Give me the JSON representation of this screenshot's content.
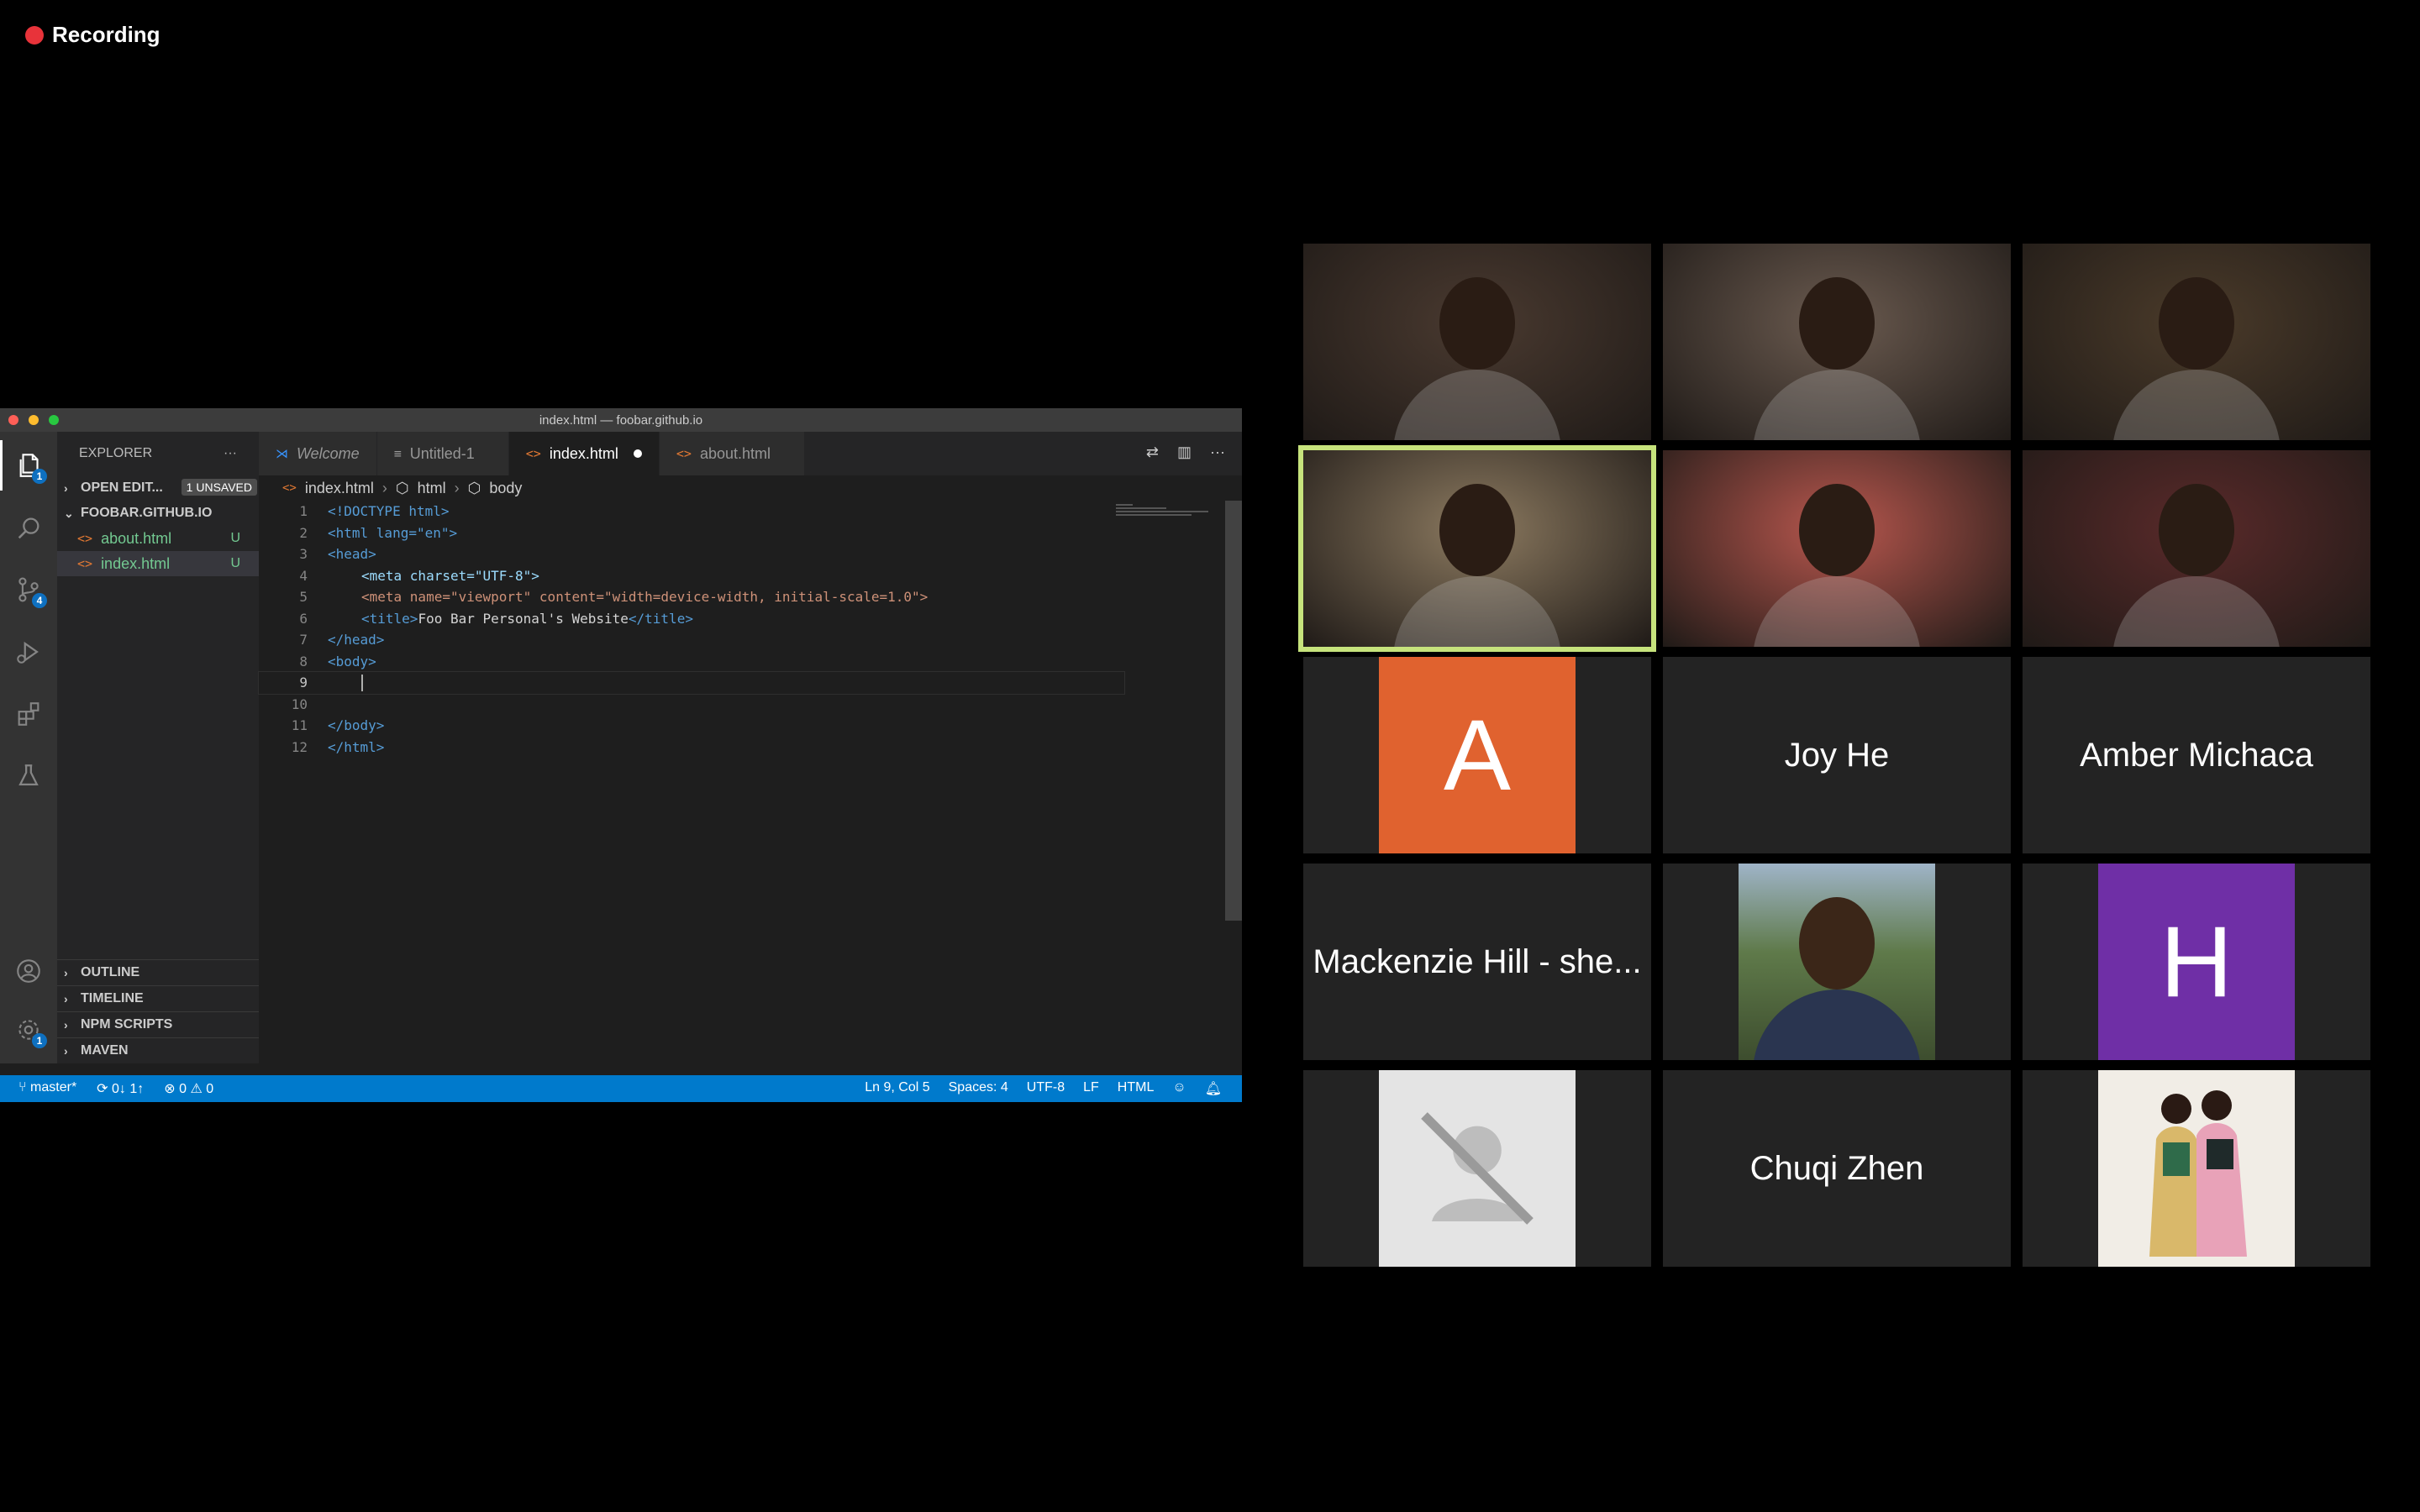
{
  "recording": {
    "label": "Recording"
  },
  "vscode": {
    "window_title": "index.html — foobar.github.io",
    "activity_badges": {
      "explorer": "1",
      "scm": "4",
      "settings": "1"
    },
    "sidebar": {
      "title": "EXPLORER",
      "more": "···",
      "open_editors": "OPEN EDIT...",
      "unsaved": "1 UNSAVED",
      "folder": "FOOBAR.GITHUB.IO",
      "files": [
        {
          "name": "about.html",
          "status": "U"
        },
        {
          "name": "index.html",
          "status": "U"
        }
      ],
      "bottom_sections": [
        "OUTLINE",
        "TIMELINE",
        "NPM SCRIPTS",
        "MAVEN"
      ]
    },
    "tabs": [
      {
        "label": "Welcome"
      },
      {
        "label": "Untitled-1"
      },
      {
        "label": "index.html"
      },
      {
        "label": "about.html"
      }
    ],
    "breadcrumbs": [
      "index.html",
      "html",
      "body"
    ],
    "line_numbers": [
      "1",
      "2",
      "3",
      "4",
      "5",
      "6",
      "7",
      "8",
      "9",
      "10",
      "11",
      "12"
    ],
    "code": {
      "l1": "<!DOCTYPE html>",
      "l2": "<html lang=\"en\">",
      "l3": "<head>",
      "l4": "<meta charset=\"UTF-8\">",
      "l5": "<meta name=\"viewport\" content=\"width=device-width, initial-scale=1.0\">",
      "l6_title": "Foo Bar Personal's Website",
      "l7": "</head>",
      "l8": "<body>",
      "l11": "</body>",
      "l12": "</html>"
    },
    "status": {
      "branch": "master*",
      "sync": "0↓ 1↑",
      "problems": "⊗ 0 ⚠ 0",
      "position": "Ln 9, Col 5",
      "spaces": "Spaces: 4",
      "encoding": "UTF-8",
      "eol": "LF",
      "language": "HTML"
    }
  },
  "gallery": {
    "participants": [
      {
        "type": "video",
        "color": "#4a3a30"
      },
      {
        "type": "video",
        "color": "#6b5b50"
      },
      {
        "type": "video",
        "color": "#4b3b2a"
      },
      {
        "type": "video",
        "color": "#8c7a60",
        "active": true
      },
      {
        "type": "video",
        "color": "#b8574e"
      },
      {
        "type": "video",
        "color": "#5a2a2a"
      },
      {
        "type": "avatar",
        "initial": "A",
        "color": "#e0622f"
      },
      {
        "type": "name",
        "name": "Joy He"
      },
      {
        "type": "name",
        "name": "Amber Michaca"
      },
      {
        "type": "name",
        "name": "Mackenzie Hill - she..."
      },
      {
        "type": "photo",
        "color": "#5f7a4a"
      },
      {
        "type": "avatar",
        "initial": "H",
        "color": "#6f2fa6"
      },
      {
        "type": "placeholder"
      },
      {
        "type": "name",
        "name": "Chuqi Zhen"
      },
      {
        "type": "illustration"
      }
    ]
  }
}
